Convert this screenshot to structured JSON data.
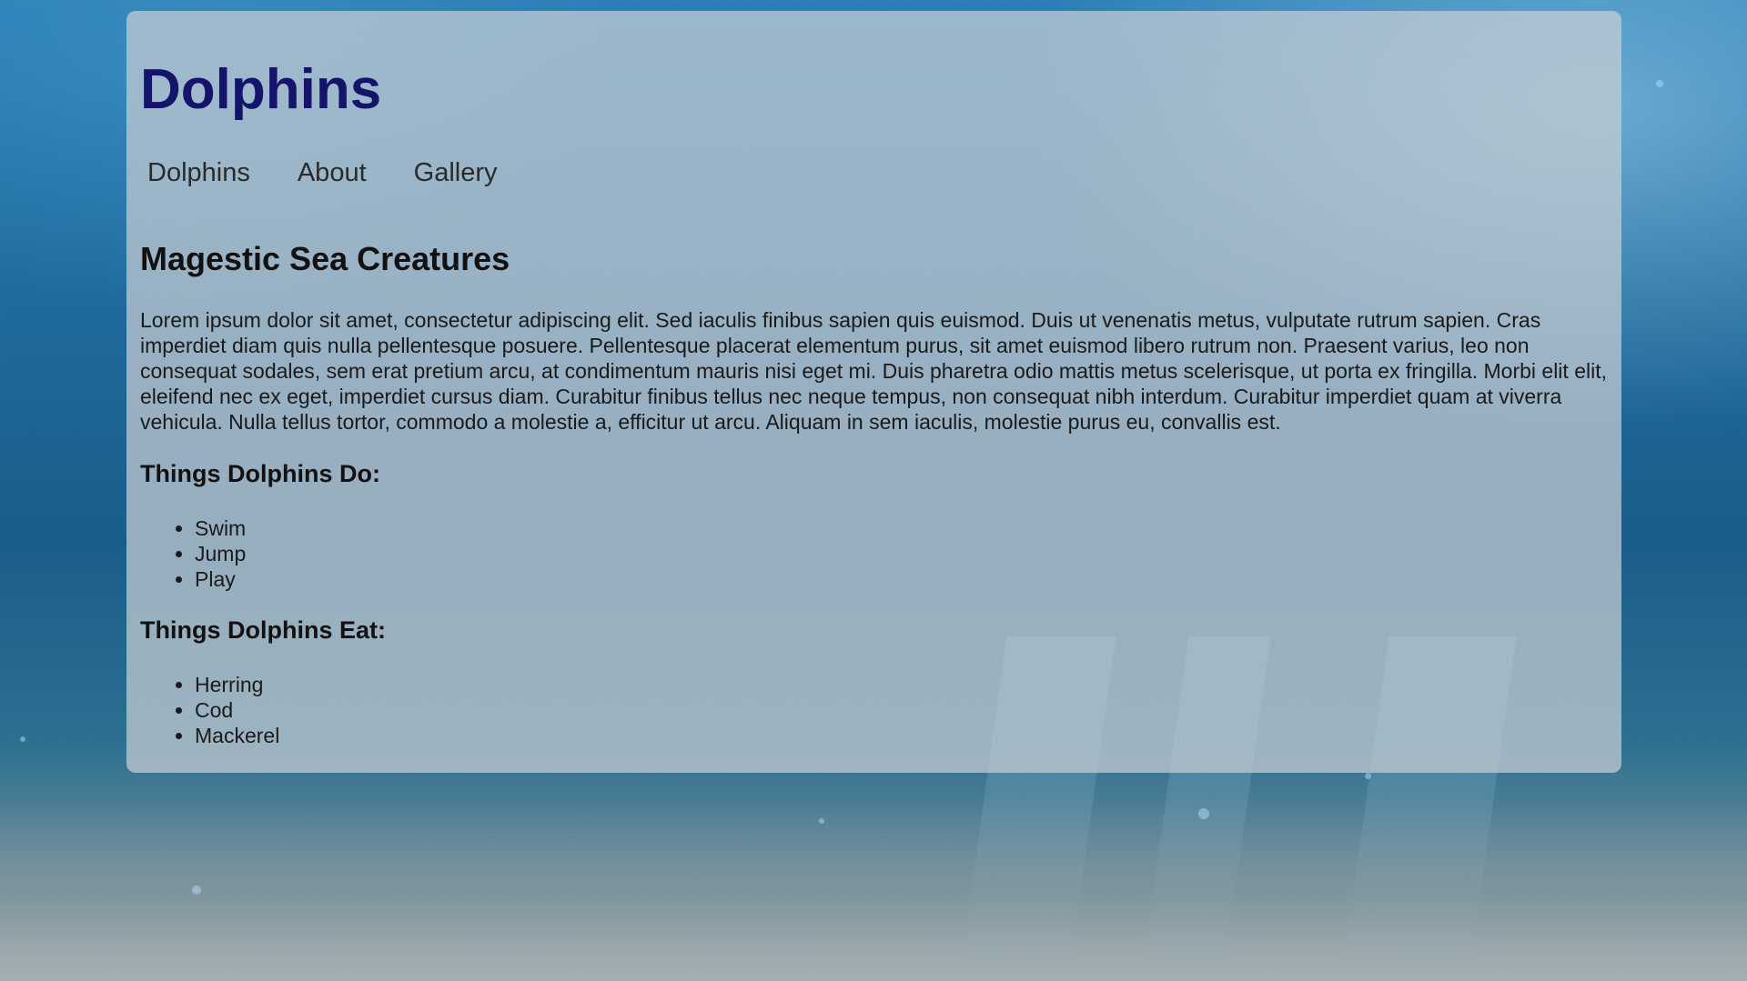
{
  "header": {
    "title": "Dolphins"
  },
  "nav": {
    "items": [
      {
        "label": "Dolphins"
      },
      {
        "label": "About"
      },
      {
        "label": "Gallery"
      }
    ]
  },
  "main": {
    "heading": "Magestic Sea Creatures",
    "intro": "Lorem ipsum dolor sit amet, consectetur adipiscing elit. Sed iaculis finibus sapien quis euismod. Duis ut venenatis metus, vulputate rutrum sapien. Cras imperdiet diam quis nulla pellentesque posuere. Pellentesque placerat elementum purus, sit amet euismod libero rutrum non. Praesent varius, leo non consequat sodales, sem erat pretium arcu, at condimentum mauris nisi eget mi. Duis pharetra odio mattis metus scelerisque, ut porta ex fringilla. Morbi elit elit, eleifend nec ex eget, imperdiet cursus diam. Curabitur finibus tellus nec neque tempus, non consequat nibh interdum. Curabitur imperdiet quam at viverra vehicula. Nulla tellus tortor, commodo a molestie a, efficitur ut arcu. Aliquam in sem iaculis, molestie purus eu, convallis est.",
    "do_section": {
      "heading": "Things Dolphins Do:",
      "items": [
        "Swim",
        "Jump",
        "Play"
      ]
    },
    "eat_section": {
      "heading": "Things Dolphins Eat:",
      "items": [
        "Herring",
        "Cod",
        "Mackerel"
      ]
    }
  },
  "colors": {
    "title": "#14146b",
    "panel": "rgba(200,205,210,0.72)"
  }
}
